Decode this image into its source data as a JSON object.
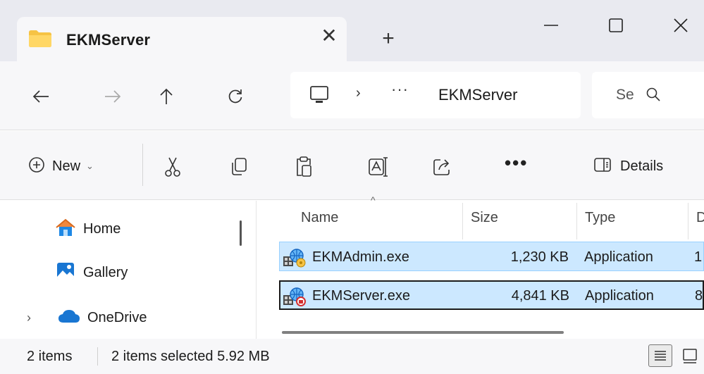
{
  "window": {
    "tab_title": "EKMServer",
    "tab_close_glyph": "✕",
    "new_tab_glyph": "+",
    "controls": [
      "minimize-icon",
      "maximize-icon",
      "close-icon"
    ]
  },
  "navigation": {
    "buttons": [
      "back-arrow-icon",
      "forward-arrow-icon",
      "up-arrow-icon",
      "refresh-icon"
    ],
    "address": {
      "root_icon": "this-pc-icon",
      "chevron": "›",
      "overflow": "···",
      "current_folder": "EKMServer"
    },
    "search": {
      "placeholder": "Se",
      "icon": "search-icon"
    }
  },
  "commandbar": {
    "new_label": "New",
    "new_chevron": "⌄",
    "icons": [
      "cut-icon",
      "copy-icon",
      "paste-icon",
      "rename-icon",
      "share-icon"
    ],
    "more": "•••",
    "details_label": "Details"
  },
  "sidebar": {
    "items": [
      {
        "label": "Home",
        "icon": "home-icon"
      },
      {
        "label": "Gallery",
        "icon": "gallery-icon"
      },
      {
        "label": "OneDrive",
        "icon": "cloud-icon",
        "expand": "›"
      }
    ]
  },
  "filelist": {
    "sort_caret": "^",
    "columns": [
      "Name",
      "Size",
      "Type",
      "D"
    ],
    "rows": [
      {
        "name": "EKMAdmin.exe",
        "size": "1,230 KB",
        "type": "Application",
        "date": "1",
        "icon": "exe-admin-icon",
        "selected": true
      },
      {
        "name": "EKMServer.exe",
        "size": "4,841 KB",
        "type": "Application",
        "date": "8",
        "icon": "exe-server-icon",
        "selected": true,
        "focused": true
      }
    ]
  },
  "statusbar": {
    "count": "2 items",
    "selected": "2 items selected 5.92 MB",
    "views": [
      "details-view-icon",
      "tiles-view-icon"
    ]
  },
  "colors": {
    "titlebar": "#e9eaf0",
    "toolbar": "#f7f7f9",
    "selection": "#cce8ff",
    "selection_border": "#99d1ff",
    "folder": "#f6c344",
    "onedrive": "#1976d2",
    "home_roof": "#f0883e"
  }
}
